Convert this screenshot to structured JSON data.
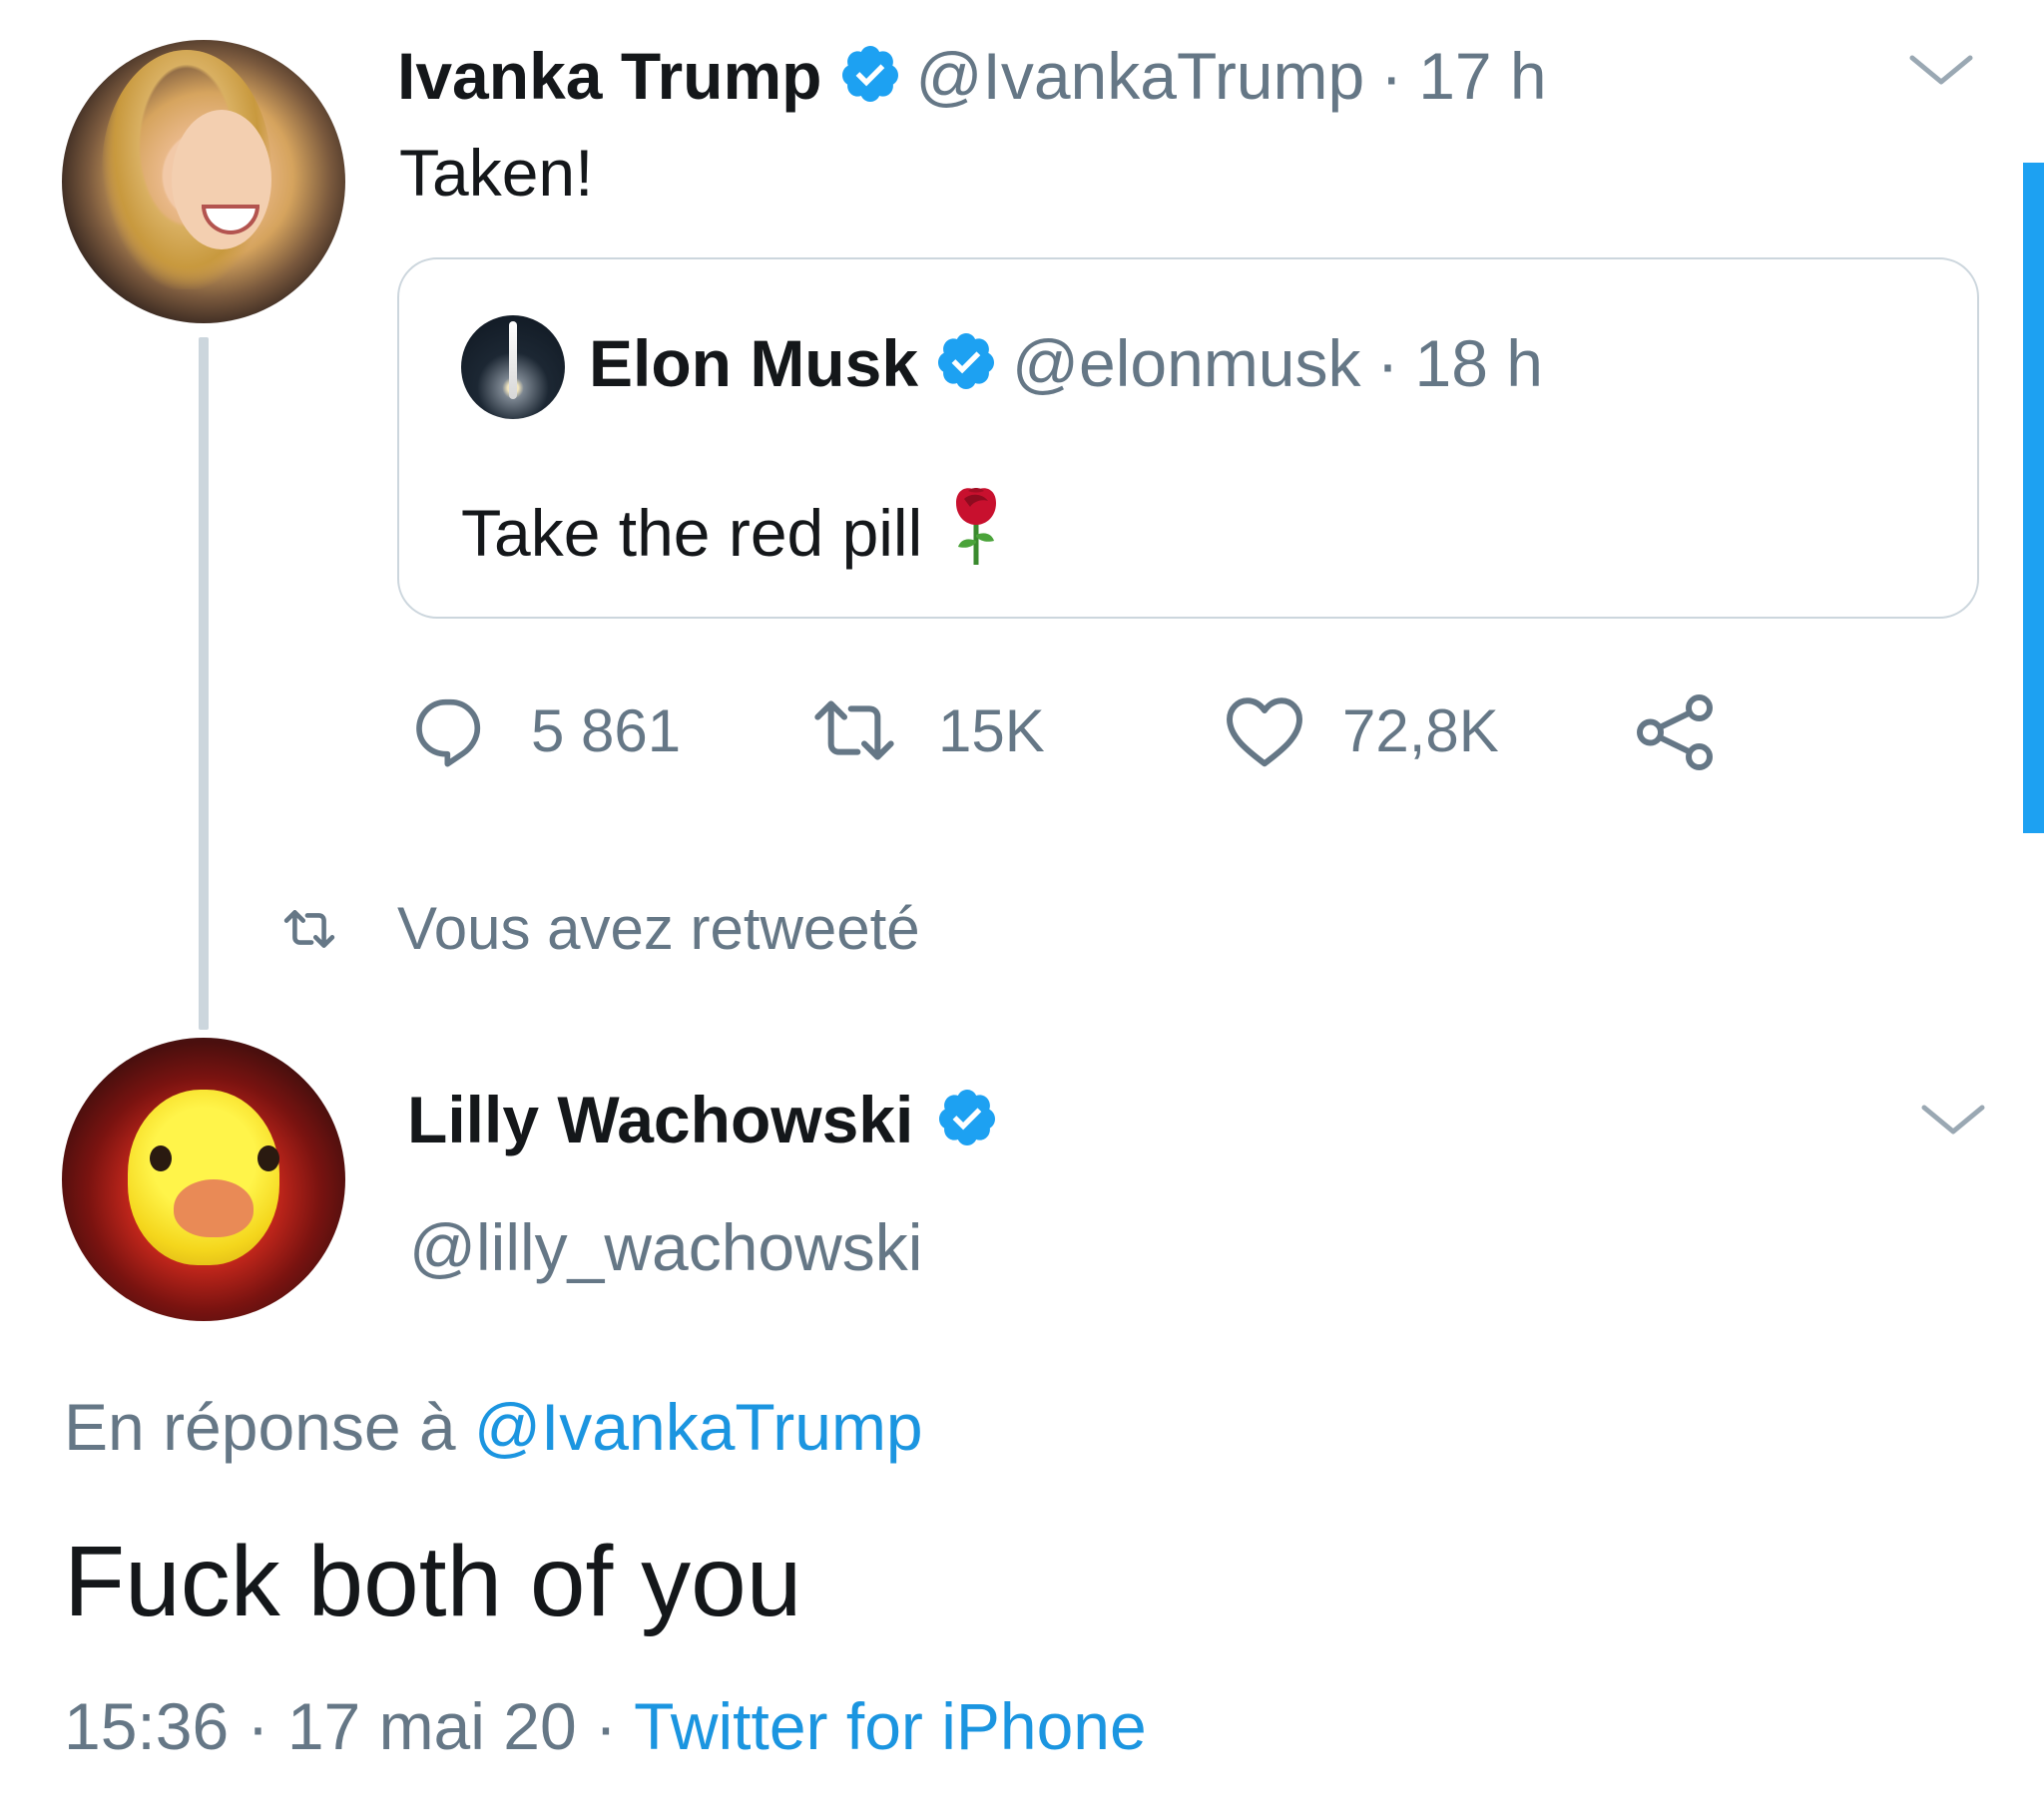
{
  "tweet1": {
    "name": "Ivanka Trump",
    "handle": "@IvankaTrump",
    "sep": "·",
    "time": "17 h",
    "text": "Taken!",
    "avatar_icon": "ivanka-avatar",
    "verified_icon": "verified-badge-icon",
    "menu_icon": "chevron-down-icon"
  },
  "quote": {
    "name": "Elon Musk",
    "handle": "@elonmusk",
    "sep": "·",
    "time": "18 h",
    "text": "Take the red pill",
    "emoji_icon": "rose-icon"
  },
  "actions": {
    "reply_count": "5 861",
    "retweet_count": "15K",
    "like_count": "72,8K",
    "reply_icon": "reply-icon",
    "retweet_icon": "retweet-icon",
    "like_icon": "heart-icon",
    "share_icon": "share-icon"
  },
  "retweeted": {
    "label": "Vous avez retweeté",
    "icon": "retweet-icon"
  },
  "tweet2": {
    "name": "Lilly Wachowski",
    "handle": "@lilly_wachowski",
    "reply_prefix": "En réponse à ",
    "reply_mention": "@IvankaTrump",
    "text": "Fuck both of you",
    "time": "15:36",
    "sep": " · ",
    "date": "17 mai 20",
    "sep2": " · ",
    "source": "Twitter for iPhone",
    "menu_icon": "chevron-down-icon"
  },
  "colors": {
    "accent": "#1da1f2",
    "link": "#1b95e0",
    "secondary_text": "#657786",
    "border": "#ccd6dd"
  }
}
